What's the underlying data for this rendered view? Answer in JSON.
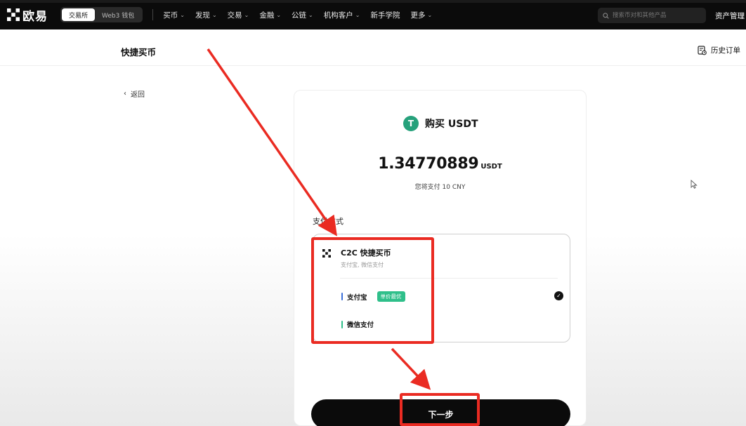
{
  "topbar": {
    "logo_text": "欧易",
    "switch": [
      "交易所",
      "Web3 钱包"
    ],
    "nav": [
      {
        "label": "买币",
        "chevron": true
      },
      {
        "label": "发现",
        "chevron": true
      },
      {
        "label": "交易",
        "chevron": true
      },
      {
        "label": "金融",
        "chevron": true
      },
      {
        "label": "公链",
        "chevron": true
      },
      {
        "label": "机构客户",
        "chevron": true
      },
      {
        "label": "新手学院",
        "chevron": false
      },
      {
        "label": "更多",
        "chevron": true
      }
    ],
    "search_placeholder": "搜索币对和其他产品",
    "assets_label": "资产管理"
  },
  "header": {
    "title": "快捷买币",
    "history_label": "历史订单"
  },
  "back_label": "返回",
  "card": {
    "coin_symbol": "T",
    "buy_title": "购买 USDT",
    "amount": "1.34770889",
    "amount_unit": "USDT",
    "pay_note": "您将支付 10 CNY",
    "payment_method_label": "支付方式",
    "c2c_title": "C2C 快捷买币",
    "c2c_subtitle": "支付宝, 微信支付",
    "options": [
      {
        "label": "支付宝",
        "badge": "单价最优",
        "bar_color": "#3b6fd8",
        "selected": true
      },
      {
        "label": "微信支付",
        "badge": "",
        "bar_color": "#2fbf8a",
        "selected": false
      }
    ],
    "next_label": "下一步"
  },
  "colors": {
    "accent_green": "#2fbf8a",
    "usdt_green": "#26a17b",
    "annotation_red": "#ea2b22"
  }
}
